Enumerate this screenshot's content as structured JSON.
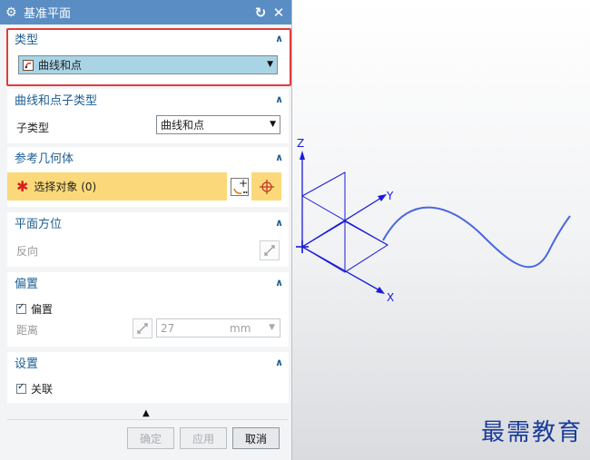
{
  "dialog": {
    "title": "基准平面",
    "sections": {
      "type": {
        "header": "类型",
        "selected": "曲线和点"
      },
      "subtype": {
        "header": "曲线和点子类型",
        "label": "子类型",
        "selected": "曲线和点"
      },
      "reference": {
        "header": "参考几何体",
        "select_object": "选择对象 (0)"
      },
      "orientation": {
        "header": "平面方位",
        "reverse_label": "反向"
      },
      "offset": {
        "header": "偏置",
        "checkbox_label": "偏置",
        "distance_label": "距离",
        "distance_value": "27",
        "distance_unit": "mm"
      },
      "settings": {
        "header": "设置",
        "associative_label": "关联"
      }
    },
    "buttons": {
      "ok": "确定",
      "apply": "应用",
      "cancel": "取消"
    }
  },
  "viewport": {
    "axes": {
      "z": "Z",
      "y": "Y",
      "x": "X"
    }
  },
  "watermark": "最需教育",
  "colors": {
    "titlebar": "#5a8dc4",
    "section_header": "#1d5e93",
    "highlight_box": "#e23b3b",
    "selection_bg": "#fbd97a",
    "axis": "#1a1adb",
    "curve": "#4a68e0"
  }
}
